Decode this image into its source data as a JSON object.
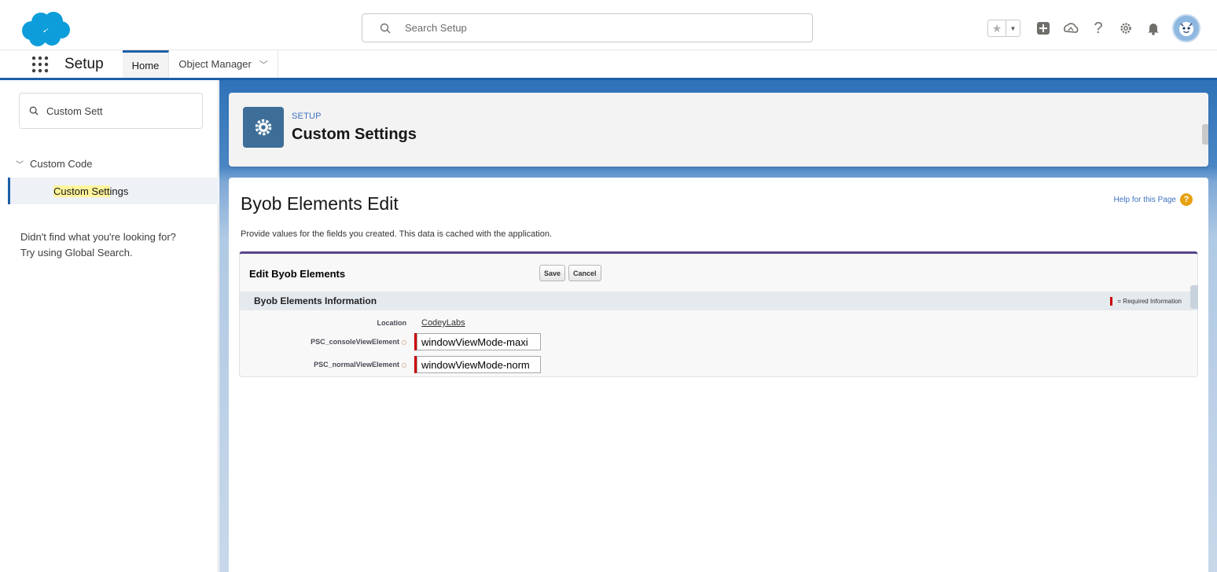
{
  "header": {
    "logo": "salesforce-cloud-logo",
    "search_placeholder": "Search Setup",
    "icons": [
      "star-icon",
      "chevron-down-icon",
      "add-icon",
      "trailhead-icon",
      "help-icon",
      "gear-icon",
      "bell-icon",
      "avatar"
    ],
    "help_glyph": "?"
  },
  "context_bar": {
    "app_name": "Setup",
    "tabs": [
      {
        "label": "Home",
        "active": true
      },
      {
        "label": "Object Manager",
        "active": false
      }
    ]
  },
  "sidebar": {
    "search_value": "Custom Sett",
    "tree_header": "Custom Code",
    "tree_item": {
      "highlight": "Custom Sett",
      "rest": "ings"
    },
    "help_text_line1": "Didn't find what you're looking for?",
    "help_text_line2": "Try using Global Search."
  },
  "page_header": {
    "eyebrow": "SETUP",
    "title": "Custom Settings"
  },
  "content": {
    "title": "Byob Elements Edit",
    "help_link": "Help for this Page",
    "description": "Provide values for the fields you created. This data is cached with the application.",
    "edit_block": {
      "title": "Edit Byob Elements",
      "save_label": "Save",
      "cancel_label": "Cancel",
      "section_title": "Byob Elements Information",
      "required_legend": "= Required Information",
      "fields": [
        {
          "label": "Location",
          "value": "CodeyLabs"
        },
        {
          "label": "PSC_consoleViewElement",
          "value": "windowViewMode-maxi"
        },
        {
          "label": "PSC_normalViewElement",
          "value": "windowViewMode-norm"
        }
      ]
    }
  },
  "colors": {
    "brand_blue": "#1b5fa8",
    "required_red": "#cc0000",
    "page_icon": "#3c6e98",
    "help_orange": "#e6a10f",
    "highlight": "#fff49c"
  }
}
